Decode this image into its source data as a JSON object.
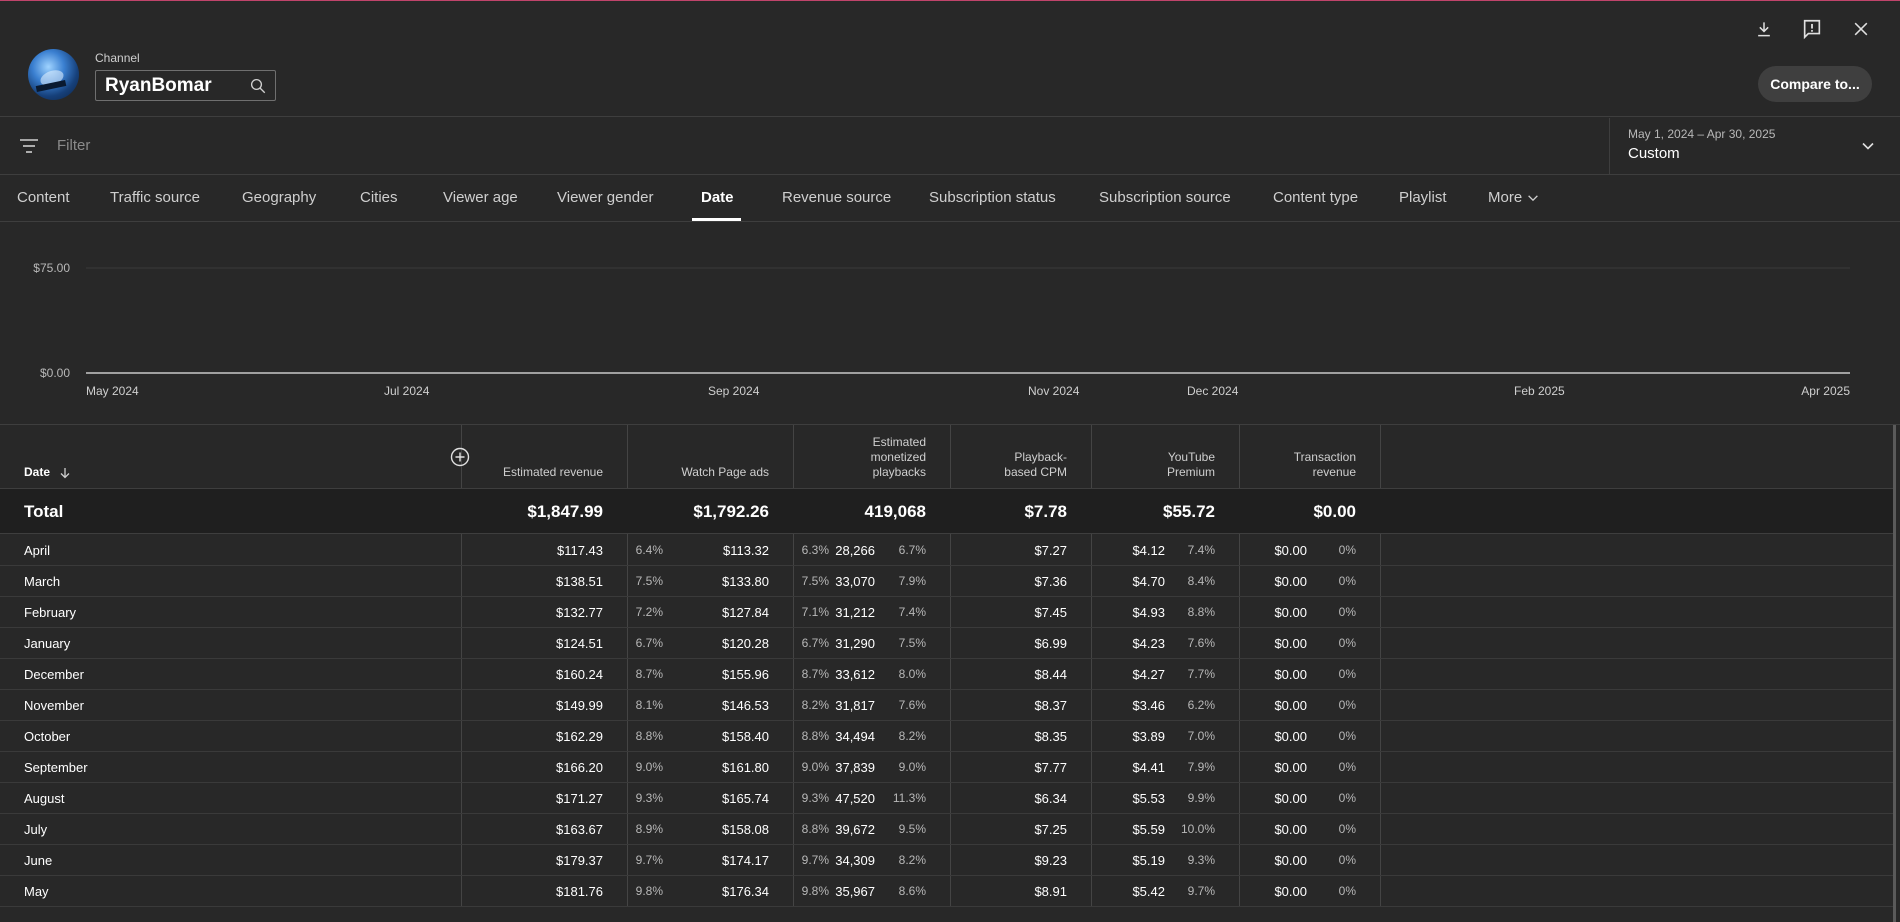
{
  "header": {
    "channel_label": "Channel",
    "channel_name": "RyanBomar",
    "compare_label": "Compare to..."
  },
  "filter": {
    "placeholder": "Filter",
    "date_range": "May 1, 2024 – Apr 30, 2025",
    "date_mode": "Custom"
  },
  "tabs": [
    {
      "label": "Content"
    },
    {
      "label": "Traffic source"
    },
    {
      "label": "Geography"
    },
    {
      "label": "Cities"
    },
    {
      "label": "Viewer age"
    },
    {
      "label": "Viewer gender"
    },
    {
      "label": "Date"
    },
    {
      "label": "Revenue source"
    },
    {
      "label": "Subscription status"
    },
    {
      "label": "Subscription source"
    },
    {
      "label": "Content type"
    },
    {
      "label": "Playlist"
    },
    {
      "label": "More"
    }
  ],
  "active_tab": "Date",
  "chart_data": {
    "type": "line",
    "y_ticks": [
      "$75.00",
      "$0.00"
    ],
    "x_ticks": [
      "May 2024",
      "Jul 2024",
      "Sep 2024",
      "Nov 2024",
      "Dec 2024",
      "Feb 2025",
      "Apr 2025"
    ],
    "ylim": [
      0,
      75
    ],
    "series": [
      {
        "values": [
          0,
          0,
          0,
          0,
          0,
          0,
          0
        ]
      }
    ],
    "grid": true
  },
  "table": {
    "columns": {
      "date": "Date",
      "est_revenue": "Estimated revenue",
      "watch_page_ads": "Watch Page ads",
      "est_playbacks_1": "Estimated",
      "est_playbacks_2": "monetized",
      "est_playbacks_3": "playbacks",
      "cpm_1": "Playback-",
      "cpm_2": "based CPM",
      "premium_1": "YouTube",
      "premium_2": "Premium",
      "transaction_1": "Transaction",
      "transaction_2": "revenue"
    },
    "total": {
      "label": "Total",
      "est_revenue": "$1,847.99",
      "watch_page_ads": "$1,792.26",
      "playbacks": "419,068",
      "cpm": "$7.78",
      "premium": "$55.72",
      "transaction": "$0.00"
    },
    "rows": [
      {
        "date": "April",
        "rev": "$117.43",
        "rev_p": "6.4%",
        "ads": "$113.32",
        "ads_p": "6.3%",
        "pb": "28,266",
        "pb_p": "6.7%",
        "cpm": "$7.27",
        "prem": "$4.12",
        "prem_p": "7.4%",
        "tx": "$0.00",
        "tx_p": "0%"
      },
      {
        "date": "March",
        "rev": "$138.51",
        "rev_p": "7.5%",
        "ads": "$133.80",
        "ads_p": "7.5%",
        "pb": "33,070",
        "pb_p": "7.9%",
        "cpm": "$7.36",
        "prem": "$4.70",
        "prem_p": "8.4%",
        "tx": "$0.00",
        "tx_p": "0%"
      },
      {
        "date": "February",
        "rev": "$132.77",
        "rev_p": "7.2%",
        "ads": "$127.84",
        "ads_p": "7.1%",
        "pb": "31,212",
        "pb_p": "7.4%",
        "cpm": "$7.45",
        "prem": "$4.93",
        "prem_p": "8.8%",
        "tx": "$0.00",
        "tx_p": "0%"
      },
      {
        "date": "January",
        "rev": "$124.51",
        "rev_p": "6.7%",
        "ads": "$120.28",
        "ads_p": "6.7%",
        "pb": "31,290",
        "pb_p": "7.5%",
        "cpm": "$6.99",
        "prem": "$4.23",
        "prem_p": "7.6%",
        "tx": "$0.00",
        "tx_p": "0%"
      },
      {
        "date": "December",
        "rev": "$160.24",
        "rev_p": "8.7%",
        "ads": "$155.96",
        "ads_p": "8.7%",
        "pb": "33,612",
        "pb_p": "8.0%",
        "cpm": "$8.44",
        "prem": "$4.27",
        "prem_p": "7.7%",
        "tx": "$0.00",
        "tx_p": "0%"
      },
      {
        "date": "November",
        "rev": "$149.99",
        "rev_p": "8.1%",
        "ads": "$146.53",
        "ads_p": "8.2%",
        "pb": "31,817",
        "pb_p": "7.6%",
        "cpm": "$8.37",
        "prem": "$3.46",
        "prem_p": "6.2%",
        "tx": "$0.00",
        "tx_p": "0%"
      },
      {
        "date": "October",
        "rev": "$162.29",
        "rev_p": "8.8%",
        "ads": "$158.40",
        "ads_p": "8.8%",
        "pb": "34,494",
        "pb_p": "8.2%",
        "cpm": "$8.35",
        "prem": "$3.89",
        "prem_p": "7.0%",
        "tx": "$0.00",
        "tx_p": "0%"
      },
      {
        "date": "September",
        "rev": "$166.20",
        "rev_p": "9.0%",
        "ads": "$161.80",
        "ads_p": "9.0%",
        "pb": "37,839",
        "pb_p": "9.0%",
        "cpm": "$7.77",
        "prem": "$4.41",
        "prem_p": "7.9%",
        "tx": "$0.00",
        "tx_p": "0%"
      },
      {
        "date": "August",
        "rev": "$171.27",
        "rev_p": "9.3%",
        "ads": "$165.74",
        "ads_p": "9.3%",
        "pb": "47,520",
        "pb_p": "11.3%",
        "cpm": "$6.34",
        "prem": "$5.53",
        "prem_p": "9.9%",
        "tx": "$0.00",
        "tx_p": "0%"
      },
      {
        "date": "July",
        "rev": "$163.67",
        "rev_p": "8.9%",
        "ads": "$158.08",
        "ads_p": "8.8%",
        "pb": "39,672",
        "pb_p": "9.5%",
        "cpm": "$7.25",
        "prem": "$5.59",
        "prem_p": "10.0%",
        "tx": "$0.00",
        "tx_p": "0%"
      },
      {
        "date": "June",
        "rev": "$179.37",
        "rev_p": "9.7%",
        "ads": "$174.17",
        "ads_p": "9.7%",
        "pb": "34,309",
        "pb_p": "8.2%",
        "cpm": "$9.23",
        "prem": "$5.19",
        "prem_p": "9.3%",
        "tx": "$0.00",
        "tx_p": "0%"
      },
      {
        "date": "May",
        "rev": "$181.76",
        "rev_p": "9.8%",
        "ads": "$176.34",
        "ads_p": "9.8%",
        "pb": "35,967",
        "pb_p": "8.6%",
        "cpm": "$8.91",
        "prem": "$5.42",
        "prem_p": "9.7%",
        "tx": "$0.00",
        "tx_p": "0%"
      }
    ]
  }
}
